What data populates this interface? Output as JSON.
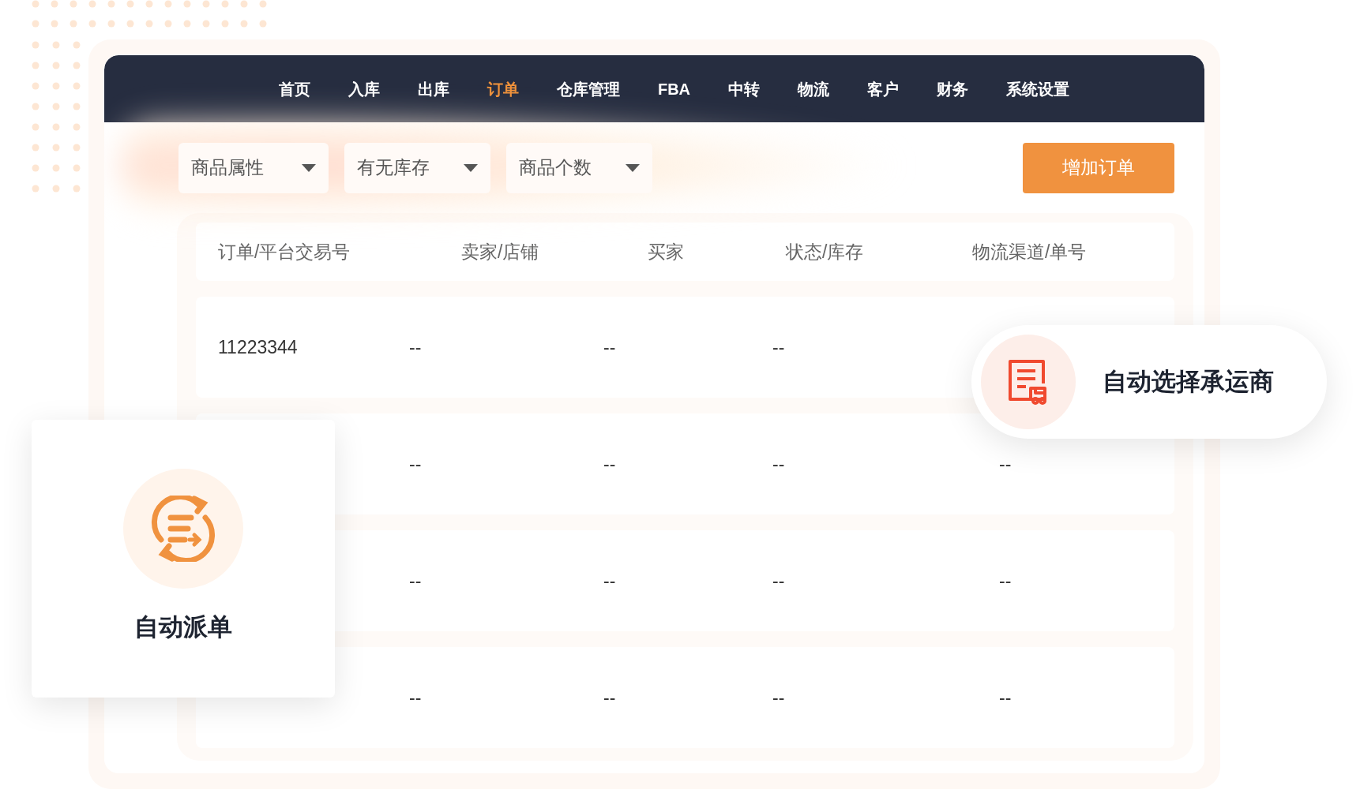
{
  "nav": {
    "items": [
      {
        "label": "首页",
        "selected": false
      },
      {
        "label": "入库",
        "selected": false
      },
      {
        "label": "出库",
        "selected": false
      },
      {
        "label": "订单",
        "selected": true
      },
      {
        "label": "仓库管理",
        "selected": false
      },
      {
        "label": "FBA",
        "selected": false
      },
      {
        "label": "中转",
        "selected": false
      },
      {
        "label": "物流",
        "selected": false
      },
      {
        "label": "客户",
        "selected": false
      },
      {
        "label": "财务",
        "selected": false
      },
      {
        "label": "系统设置",
        "selected": false
      }
    ]
  },
  "filters": [
    {
      "label": "商品属性"
    },
    {
      "label": "有无库存"
    },
    {
      "label": "商品个数"
    }
  ],
  "add_button": {
    "label": "增加订单"
  },
  "table": {
    "columns": [
      "订单/平台交易号",
      "卖家/店铺",
      "买家",
      "状态/库存",
      "物流渠道/单号"
    ],
    "rows": [
      {
        "order_id": "11223344",
        "seller": "--",
        "buyer": "--",
        "status": "--"
      },
      {
        "seller": "--",
        "buyer": "--",
        "status": "--",
        "logistics": "--"
      },
      {
        "seller": "--",
        "buyer": "--",
        "status": "--",
        "logistics": "--"
      },
      {
        "seller": "--",
        "buyer": "--",
        "status": "--",
        "logistics": "--"
      }
    ]
  },
  "feature_card": {
    "label": "自动派单"
  },
  "feature_pill": {
    "label": "自动选择承运商"
  }
}
